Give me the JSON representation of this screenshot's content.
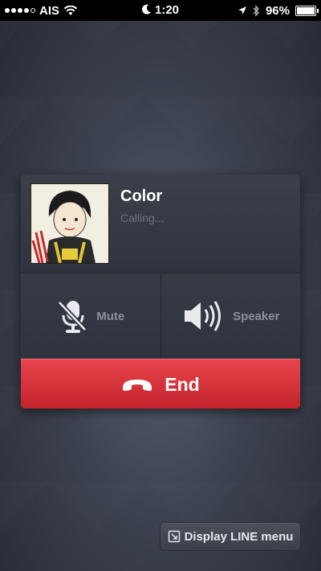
{
  "status_bar": {
    "carrier": "AIS",
    "time": "1:20",
    "battery": "96%",
    "battery_level": 0.96,
    "signal_bars": 4
  },
  "call": {
    "contact_name": "Color",
    "status": "Calling..."
  },
  "controls": {
    "mute_label": "Mute",
    "speaker_label": "Speaker",
    "end_label": "End"
  },
  "menu": {
    "display_line_label": "Display LINE menu"
  },
  "colors": {
    "end_red": "#d3333b",
    "background": "#3c424f"
  }
}
